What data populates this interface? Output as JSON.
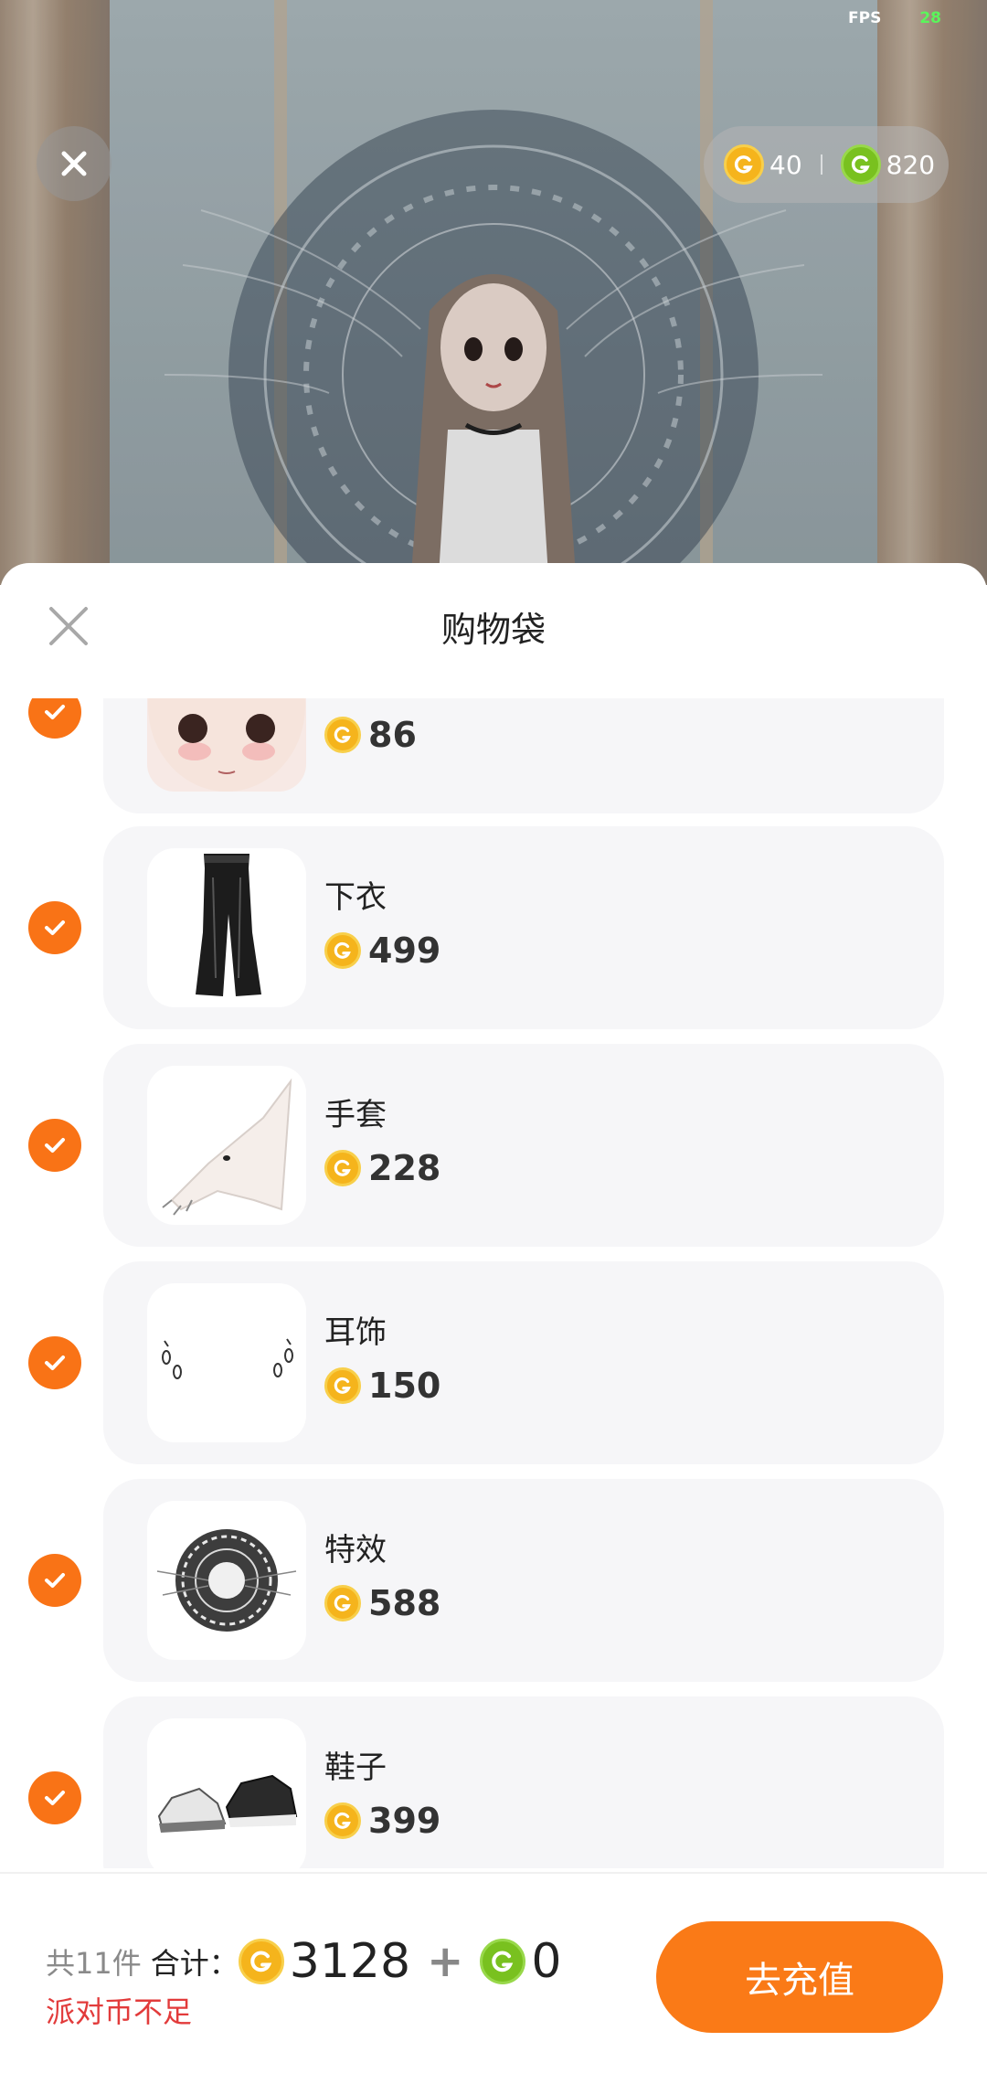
{
  "fps": {
    "label": "FPS",
    "value": "28"
  },
  "currencies": [
    {
      "icon": "gold-coin-icon",
      "value": "40"
    },
    {
      "icon": "green-coin-icon",
      "value": "820"
    }
  ],
  "sheet": {
    "title": "购物袋"
  },
  "items": [
    {
      "name": "",
      "price": "86",
      "thumb": "face-thumbnail"
    },
    {
      "name": "下衣",
      "price": "499",
      "thumb": "pants-thumbnail"
    },
    {
      "name": "手套",
      "price": "228",
      "thumb": "glove-hand-thumbnail"
    },
    {
      "name": "耳饰",
      "price": "150",
      "thumb": "earrings-thumbnail"
    },
    {
      "name": "特效",
      "price": "588",
      "thumb": "magic-circle-thumbnail"
    },
    {
      "name": "鞋子",
      "price": "399",
      "thumb": "sneakers-thumbnail"
    }
  ],
  "footer": {
    "count": "共11件",
    "total_label": "合计：",
    "gold_total": "3128",
    "plus": "+",
    "green_total": "0",
    "warning": "派对币不足",
    "recharge": "去充值"
  },
  "colors": {
    "accent": "#fa7a17",
    "check": "#f97316",
    "warning": "#e23b3b",
    "gold_coin": "#f5b41c",
    "green_coin": "#79c11f"
  }
}
